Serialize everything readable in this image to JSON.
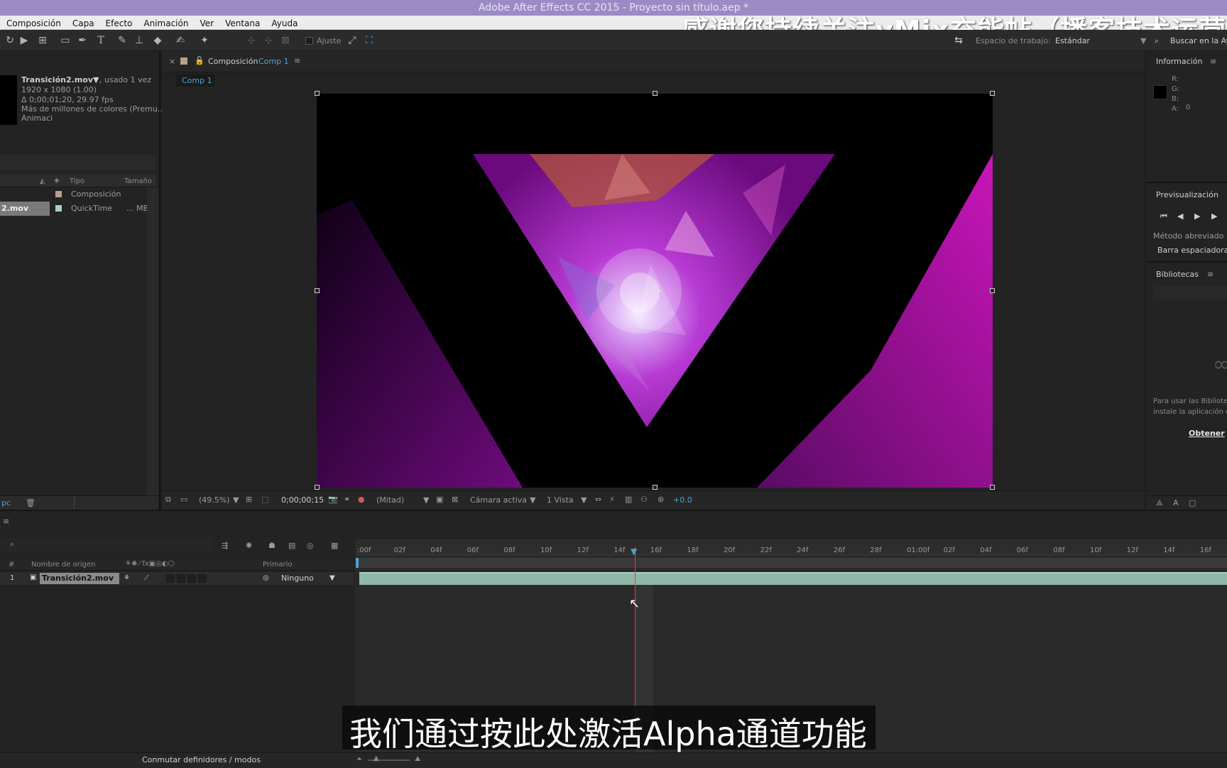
{
  "window": {
    "title": "Adobe After Effects CC 2015 - Proyecto sin título.aep *"
  },
  "watermark": "感谢您持续关注vMix充能帖（播客技术运营中",
  "menu": [
    "Composición",
    "Capa",
    "Efecto",
    "Animación",
    "Ver",
    "Ventana",
    "Ayuda"
  ],
  "toolbar": {
    "snap_label": "Ajuste",
    "workspace_label": "Espacio de trabajo:",
    "workspace_value": "Estándar",
    "search_placeholder": "Buscar en la Ayu"
  },
  "project": {
    "item_name": "Transición2.mov",
    "item_used": ", usado 1 vez",
    "item_res": "1920 x 1080 (1.00)",
    "item_duration": "Δ 0;00;01;20, 29.97 fps",
    "item_colors": "Más de millones de colores (Premu...",
    "item_anim": "Animaci",
    "col_type": "Tipo",
    "col_size": "Tamaño",
    "rows": [
      {
        "name": "",
        "type": "Composición",
        "size": ""
      },
      {
        "name": "2.mov",
        "type": "QuickTime",
        "size": "... MB"
      }
    ],
    "bpc": "pc"
  },
  "viewer": {
    "tab_label": "Composición",
    "tab_comp": "Comp 1",
    "subtab": "Comp 1",
    "zoom": "(49.5%)",
    "timecode": "0;00;00;15",
    "resolution": "(Mitad)",
    "camera": "Cámara activa",
    "views": "1 Vista",
    "exposure": "+0.0"
  },
  "info": {
    "title": "Información",
    "r": "R:",
    "g": "G:",
    "b": "B:",
    "a": "A:",
    "a_val": "0"
  },
  "preview": {
    "title": "Previsualización",
    "shortcut_label": "Método abreviado",
    "shortcut_value": "Barra espaciadora"
  },
  "libraries": {
    "title": "Bibliotecas",
    "msg1": "Para usar las Bibliotec",
    "msg2": "instale la aplicación d",
    "link": "Obtener"
  },
  "timeline": {
    "col_num": "#",
    "col_source": "Nombre de origen",
    "col_parent": "Primario",
    "layer_num": "1",
    "layer_name": "Transición2.mov",
    "layer_parent": "Ninguno",
    "ticks": [
      ":00f",
      "02f",
      "04f",
      "06f",
      "08f",
      "10f",
      "12f",
      "14f",
      "16f",
      "18f",
      "20f",
      "22f",
      "24f",
      "26f",
      "28f",
      "01:00f",
      "02f",
      "04f",
      "06f",
      "08f",
      "10f",
      "12f",
      "14f",
      "16f"
    ],
    "footer": "Conmutar definidores / modos"
  },
  "subtitle": "我们通过按此处激活Alpha通道功能",
  "colors": {
    "accent": "#4fa3d1",
    "titlebar": "#9b8bc4",
    "playhead": "#e04040",
    "layer_bar": "#8fb8a8"
  }
}
